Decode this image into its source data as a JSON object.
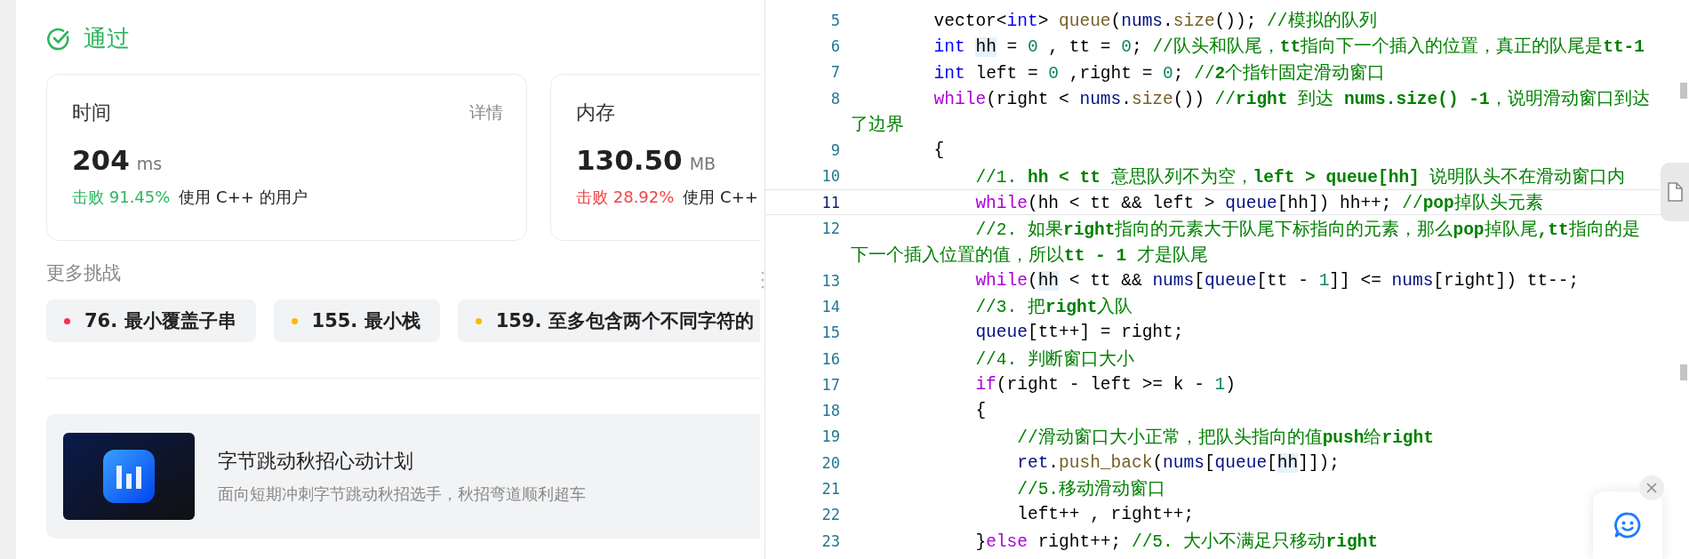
{
  "result": {
    "status": "通过"
  },
  "cards": [
    {
      "title": "时间",
      "detail": "详情",
      "value": "204",
      "unit": "ms",
      "beat": "击败 91.45%",
      "color": "#2db55d",
      "note": "使用 C++ 的用户"
    },
    {
      "title": "内存",
      "value": "130.50",
      "unit": "MB",
      "beat": "击败 28.92%",
      "color": "#f04646",
      "note": "使用 C++"
    }
  ],
  "more": {
    "title": "更多挑战",
    "items": [
      {
        "label": "76. 最小覆盖子串",
        "color": "#ff2d55"
      },
      {
        "label": "155. 最小栈",
        "color": "#ffb800"
      },
      {
        "label": "159. 至多包含两个不同字符的",
        "color": "#ffb800"
      }
    ]
  },
  "promo": {
    "title": "字节跳动秋招心动计划",
    "subtitle": "面向短期冲刺字节跳动秋招选手，秋招弯道顺利超车"
  },
  "code": {
    "lines": [
      {
        "number": "5",
        "current": false,
        "tokens": [
          {
            "kind": "plain",
            "text": "        vector<"
          },
          {
            "kind": "type",
            "text": "int"
          },
          {
            "kind": "plain",
            "text": "> "
          },
          {
            "kind": "func",
            "text": "queue"
          },
          {
            "kind": "plain",
            "text": "("
          },
          {
            "kind": "var",
            "text": "nums"
          },
          {
            "kind": "plain",
            "text": "."
          },
          {
            "kind": "func",
            "text": "size"
          },
          {
            "kind": "plain",
            "text": "()); "
          },
          {
            "kind": "comment",
            "text": "//模拟的队列"
          }
        ]
      },
      {
        "number": "6",
        "current": false,
        "tokens": [
          {
            "kind": "type",
            "text": "        int "
          },
          {
            "kind": "mark",
            "text": "hh"
          },
          {
            "kind": "plain",
            "text": " = "
          },
          {
            "kind": "num",
            "text": "0"
          },
          {
            "kind": "plain",
            "text": " , tt = "
          },
          {
            "kind": "num",
            "text": "0"
          },
          {
            "kind": "plain",
            "text": "; "
          },
          {
            "kind": "comment",
            "text": "//队头和队尾，**tt**指向下一个插入的位置，真正的队尾是**tt-1**"
          }
        ]
      },
      {
        "number": "7",
        "current": false,
        "tokens": [
          {
            "kind": "type",
            "text": "        int"
          },
          {
            "kind": "plain",
            "text": " left = "
          },
          {
            "kind": "num",
            "text": "0"
          },
          {
            "kind": "plain",
            "text": " ,right = "
          },
          {
            "kind": "num",
            "text": "0"
          },
          {
            "kind": "plain",
            "text": "; "
          },
          {
            "kind": "comment",
            "text": "//**2**个指针固定滑动窗口"
          }
        ]
      },
      {
        "number": "8",
        "current": false,
        "tokens": [
          {
            "kind": "keyword",
            "text": "        while"
          },
          {
            "kind": "plain",
            "text": "(right < "
          },
          {
            "kind": "var",
            "text": "nums"
          },
          {
            "kind": "plain",
            "text": "."
          },
          {
            "kind": "func",
            "text": "size"
          },
          {
            "kind": "plain",
            "text": "()) "
          },
          {
            "kind": "comment",
            "text": "//**right** 到达 **nums.size() -1**，说明滑动窗口到达"
          }
        ],
        "wrap": "了边界"
      },
      {
        "number": "9",
        "current": false,
        "tokens": [
          {
            "kind": "plain",
            "text": "        {"
          }
        ]
      },
      {
        "number": "10",
        "current": false,
        "tokens": [
          {
            "kind": "comment",
            "text": "            //1. **hh < tt** 意思队列不为空，**left > queue[hh]** 说明队头不在滑动窗口内"
          }
        ]
      },
      {
        "number": "11",
        "current": true,
        "tokens": [
          {
            "kind": "keyword",
            "text": "            while"
          },
          {
            "kind": "plain",
            "text": "(hh < tt && left > "
          },
          {
            "kind": "var",
            "text": "queue"
          },
          {
            "kind": "plain",
            "text": "[hh]) hh++; "
          },
          {
            "kind": "comment",
            "text": "//**pop**掉队头元素"
          }
        ]
      },
      {
        "number": "12",
        "current": false,
        "tokens": [
          {
            "kind": "comment",
            "text": "            //2. 如果**right**指向的元素大于队尾下标指向的元素，那么**pop**掉队尾**,tt**指向的是"
          }
        ],
        "wrap": "下一个插入位置的值，所以**tt - 1** 才是队尾"
      },
      {
        "number": "13",
        "current": false,
        "tokens": [
          {
            "kind": "keyword",
            "text": "            while"
          },
          {
            "kind": "plain",
            "text": "("
          },
          {
            "kind": "mark",
            "text": "hh"
          },
          {
            "kind": "plain",
            "text": " < tt && "
          },
          {
            "kind": "var",
            "text": "nums"
          },
          {
            "kind": "plain",
            "text": "["
          },
          {
            "kind": "var",
            "text": "queue"
          },
          {
            "kind": "plain",
            "text": "[tt - "
          },
          {
            "kind": "num",
            "text": "1"
          },
          {
            "kind": "plain",
            "text": "]] <= "
          },
          {
            "kind": "var",
            "text": "nums"
          },
          {
            "kind": "plain",
            "text": "[right]) tt--;"
          }
        ]
      },
      {
        "number": "14",
        "current": false,
        "tokens": [
          {
            "kind": "comment",
            "text": "            //3. 把**right**入队"
          }
        ]
      },
      {
        "number": "15",
        "current": false,
        "tokens": [
          {
            "kind": "var",
            "text": "            queue"
          },
          {
            "kind": "plain",
            "text": "[tt++] = right;"
          }
        ]
      },
      {
        "number": "16",
        "current": false,
        "tokens": [
          {
            "kind": "comment",
            "text": "            //4. 判断窗口大小"
          }
        ]
      },
      {
        "number": "17",
        "current": false,
        "tokens": [
          {
            "kind": "keyword",
            "text": "            if"
          },
          {
            "kind": "plain",
            "text": "(right - left >= k - "
          },
          {
            "kind": "num",
            "text": "1"
          },
          {
            "kind": "plain",
            "text": ")"
          }
        ]
      },
      {
        "number": "18",
        "current": false,
        "tokens": [
          {
            "kind": "plain",
            "text": "            {"
          }
        ]
      },
      {
        "number": "19",
        "current": false,
        "tokens": [
          {
            "kind": "comment",
            "text": "                //滑动窗口大小正常，把队头指向的值**push**给**right**"
          }
        ]
      },
      {
        "number": "20",
        "current": false,
        "tokens": [
          {
            "kind": "var",
            "text": "                ret"
          },
          {
            "kind": "plain",
            "text": "."
          },
          {
            "kind": "func",
            "text": "push_back"
          },
          {
            "kind": "plain",
            "text": "("
          },
          {
            "kind": "var",
            "text": "nums"
          },
          {
            "kind": "plain",
            "text": "["
          },
          {
            "kind": "var",
            "text": "queue"
          },
          {
            "kind": "plain",
            "text": "["
          },
          {
            "kind": "mark",
            "text": "hh"
          },
          {
            "kind": "plain",
            "text": "]]);"
          }
        ]
      },
      {
        "number": "21",
        "current": false,
        "tokens": [
          {
            "kind": "comment",
            "text": "                //5.移动滑动窗口"
          }
        ]
      },
      {
        "number": "22",
        "current": false,
        "tokens": [
          {
            "kind": "plain",
            "text": "                left++ , right++;"
          }
        ]
      },
      {
        "number": "23",
        "current": false,
        "tokens": [
          {
            "kind": "plain",
            "text": "            }"
          },
          {
            "kind": "keyword",
            "text": "else"
          },
          {
            "kind": "plain",
            "text": " right++; "
          },
          {
            "kind": "comment",
            "text": "//5. 大小不满足只移动**right**"
          }
        ]
      }
    ]
  }
}
